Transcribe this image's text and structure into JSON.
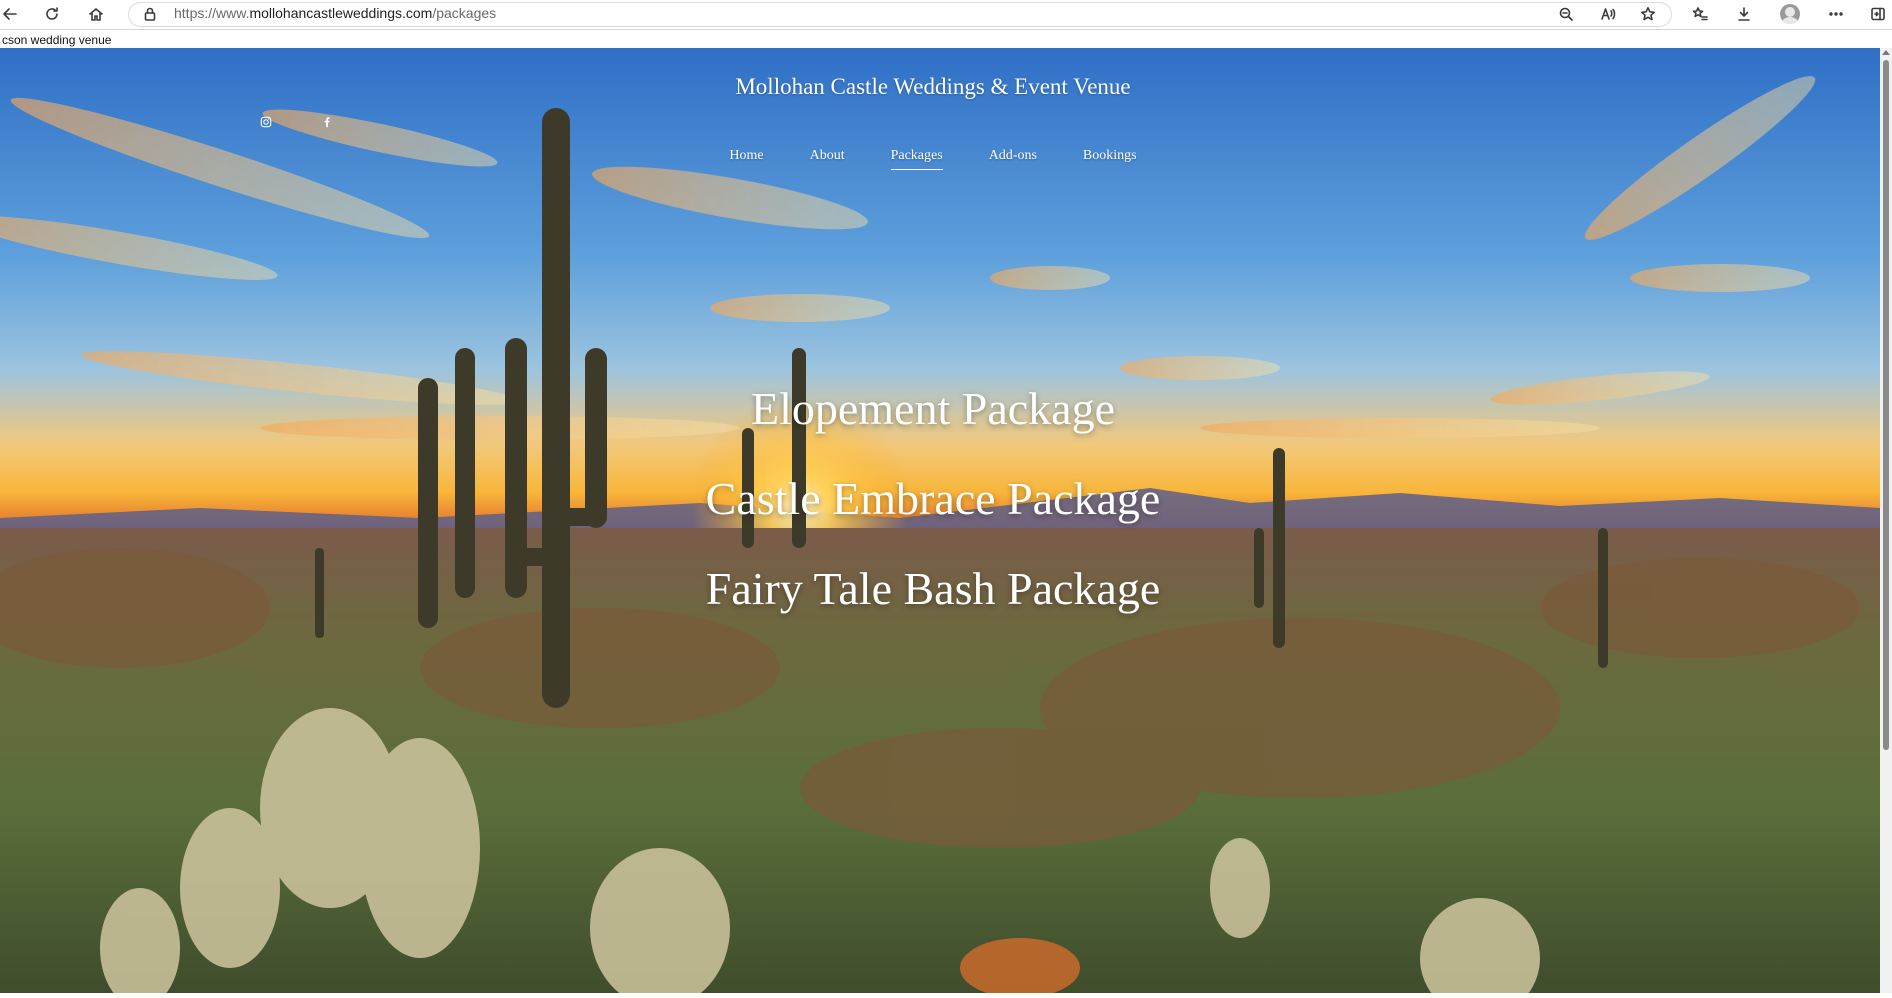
{
  "browser": {
    "url_prefix": "https://www.",
    "url_host": "mollohancastleweddings.com",
    "url_path": "/packages",
    "icons": [
      "back-arrow-icon",
      "refresh-icon",
      "home-icon",
      "lock-icon",
      "zoom-out-icon",
      "read-aloud-icon",
      "favorite-star-icon",
      "favorites-list-icon",
      "downloads-icon",
      "profile-avatar-icon",
      "more-menu-icon",
      "sidebar-toggle-icon"
    ]
  },
  "tooltip": "cson wedding venue",
  "site": {
    "title": "Mollohan Castle Weddings & Event Venue",
    "social": [
      "instagram-icon",
      "facebook-icon"
    ]
  },
  "nav": {
    "items": [
      "Home",
      "About",
      "Packages",
      "Add-ons",
      "Bookings"
    ],
    "active": "Packages"
  },
  "packages": {
    "items": [
      "Elopement Package",
      "Castle Embrace Package",
      "Fairy Tale Bash Package"
    ]
  },
  "colors": {
    "hero_text": "#ffffff",
    "sky_top": "#3a7fd0",
    "sunset": "#f6c445",
    "desert_ground": "#5d6a3a"
  }
}
